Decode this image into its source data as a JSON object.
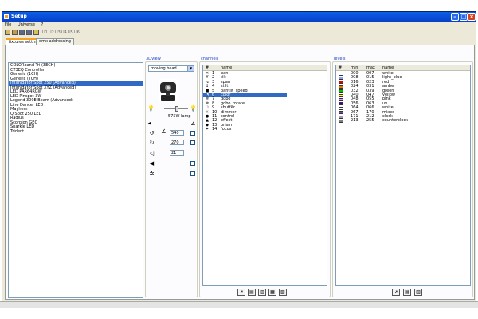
{
  "window": {
    "title": "Setup"
  },
  "menu": [
    {
      "label": "File"
    },
    {
      "label": "Universe"
    },
    {
      "label": "?"
    }
  ],
  "toolbar_universes": [
    "U1",
    "U2",
    "U3",
    "U4",
    "U5",
    "U6"
  ],
  "tabs": [
    {
      "label": "fixtures setting"
    },
    {
      "label": "dmx addressing"
    }
  ],
  "fixtures": [
    "COLORband Tri (3ECH)",
    "CT3EQ Controller",
    "Generic (1CH)",
    "Generic (TCH)",
    "Intimidator Spot 250 (Advanced)",
    "Intimidator Spot XYZ (Advanced)",
    "LED PAR64RGW",
    "LED Pinspot 3W",
    "Legend 300E Beam (Advanced)",
    "Line Dancer LED",
    "Mayhem",
    "Q Spot 250 LED",
    "Radius",
    "Scorpion GEC",
    "Sparkle LED",
    "Trident"
  ],
  "selected_fixture_index": 4,
  "view3d": {
    "label": "3DView",
    "fixture_type": "moving head",
    "lamp_label": "575W lamp",
    "pan_value": "540",
    "tilt_value": "270",
    "zoom_value": "21"
  },
  "channels": {
    "label": "channels",
    "headers": [
      "#",
      "name"
    ],
    "items": [
      {
        "n": "1",
        "name": "pan",
        "icon": "✕"
      },
      {
        "n": "2",
        "name": "tilt",
        "icon": "Y"
      },
      {
        "n": "3",
        "name": "span",
        "icon": "↘"
      },
      {
        "n": "4",
        "name": "stilt",
        "icon": "↕"
      },
      {
        "n": "5",
        "name": "pantilt_speed",
        "icon": "■"
      },
      {
        "n": "6",
        "name": "color",
        "icon": "◔"
      },
      {
        "n": "7",
        "name": "gobo",
        "icon": "✲"
      },
      {
        "n": "8",
        "name": "gobo_rotate",
        "icon": "✲"
      },
      {
        "n": "9",
        "name": "shutter",
        "icon": "☽"
      },
      {
        "n": "10",
        "name": "dimmer",
        "icon": "☼"
      },
      {
        "n": "11",
        "name": "control",
        "icon": "●"
      },
      {
        "n": "12",
        "name": "effect",
        "icon": "▲"
      },
      {
        "n": "13",
        "name": "prism",
        "icon": "◆"
      },
      {
        "n": "14",
        "name": "focus",
        "icon": "✦"
      }
    ],
    "selected_index": 5
  },
  "levels": {
    "label": "levels",
    "headers": [
      "#",
      "min",
      "max",
      "name"
    ],
    "items": [
      {
        "min": "000",
        "max": "007",
        "name": "white",
        "color": "#ffffff"
      },
      {
        "min": "008",
        "max": "015",
        "name": "light_blue",
        "color": "#80a0ff"
      },
      {
        "min": "016",
        "max": "023",
        "name": "red",
        "color": "#e00000"
      },
      {
        "min": "024",
        "max": "031",
        "name": "amber",
        "color": "#e08000"
      },
      {
        "min": "032",
        "max": "039",
        "name": "green",
        "color": "#00c000"
      },
      {
        "min": "040",
        "max": "047",
        "name": "yellow",
        "color": "#ffff00"
      },
      {
        "min": "048",
        "max": "055",
        "name": "pink",
        "color": "#ff80ff"
      },
      {
        "min": "056",
        "max": "063",
        "name": "uv",
        "color": "#4000c0"
      },
      {
        "min": "064",
        "max": "066",
        "name": "white",
        "color": "#ffffff"
      },
      {
        "min": "067",
        "max": "170",
        "name": "mixed",
        "color": "#8040c0"
      },
      {
        "min": "171",
        "max": "212",
        "name": "clock",
        "color": "#a0a0a0"
      },
      {
        "min": "213",
        "max": "255",
        "name": "counterclock",
        "color": "#808080"
      }
    ]
  }
}
